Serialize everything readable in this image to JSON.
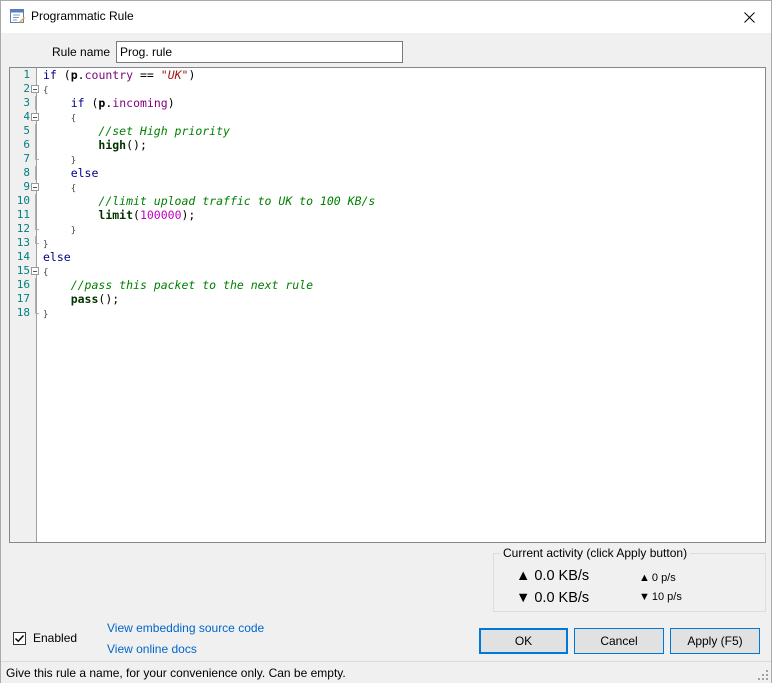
{
  "window": {
    "title": "Programmatic Rule",
    "close_icon": "close-icon"
  },
  "rule_name": {
    "label": "Rule name",
    "value": "Prog. rule"
  },
  "editor": {
    "line_numbers": [
      "1",
      "2",
      "3",
      "4",
      "5",
      "6",
      "7",
      "8",
      "9",
      "10",
      "11",
      "12",
      "13",
      "14",
      "15",
      "16",
      "17",
      "18"
    ],
    "code_lines": [
      "if (p.country == \"UK\")",
      "{",
      "    if (p.incoming)",
      "    {",
      "        //set High priority",
      "        high();",
      "    }",
      "    else",
      "    {",
      "        //limit upload traffic to UK to 100 KB/s",
      "        limit(100000);",
      "    }",
      "}",
      "else",
      "{",
      "    //pass this packet to the next rule",
      "    pass();",
      "}"
    ]
  },
  "activity": {
    "legend": "Current activity (click Apply button)",
    "up_rate": "0.0 KB/s",
    "down_rate": "0.0 KB/s",
    "up_packets": "0 p/s",
    "down_packets": "10 p/s",
    "up_arrow": "▲",
    "down_arrow": "▼"
  },
  "controls": {
    "enabled_label": "Enabled",
    "enabled_checked": true,
    "link_embedding": "View embedding source code",
    "link_docs": "View online docs",
    "ok_label": "OK",
    "cancel_label": "Cancel",
    "apply_label": "Apply (F5)"
  },
  "status": {
    "text": "Give this rule a name, for your convenience only. Can be empty."
  },
  "colors": {
    "accent": "#0078d7",
    "link": "#0066cc",
    "line_number": "#008080",
    "comment": "#008000",
    "string": "#a31515",
    "number": "#c000c0"
  }
}
